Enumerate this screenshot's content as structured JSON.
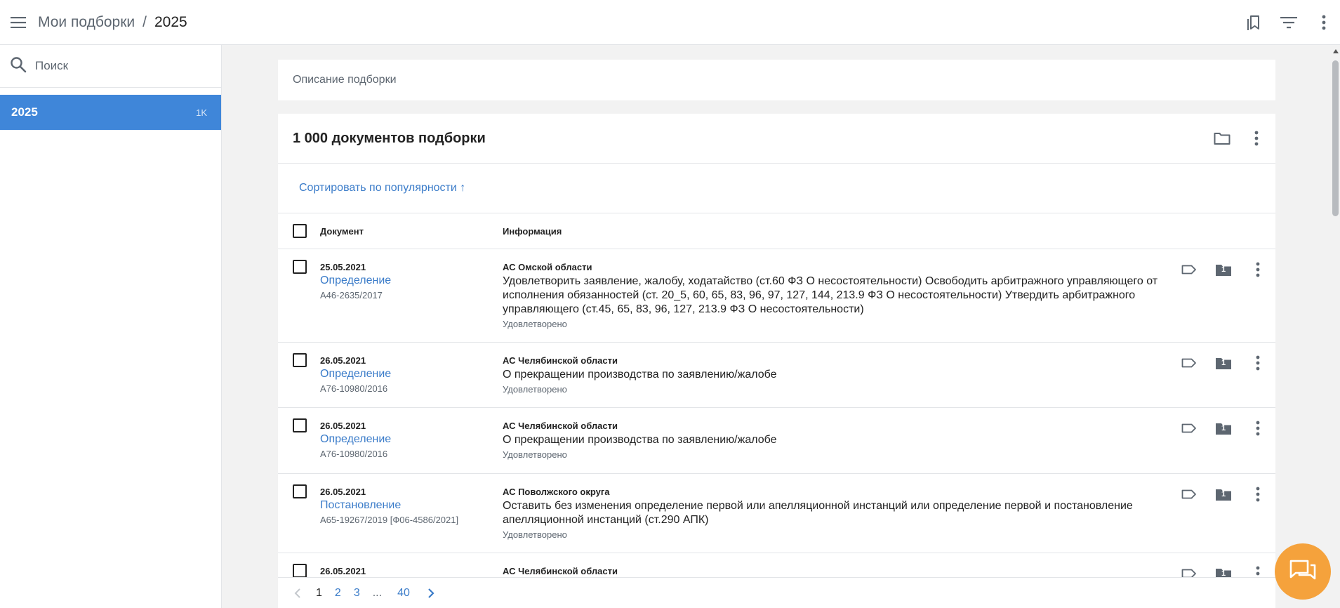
{
  "header": {
    "crumb_parent": "Мои подборки",
    "crumb_separator": "/",
    "crumb_current": "2025"
  },
  "sidebar": {
    "search_placeholder": "Поиск",
    "items": [
      {
        "label": "2025",
        "count": "1K"
      }
    ]
  },
  "main": {
    "description_placeholder": "Описание подборки",
    "docs_title": "1 000 документов подборки",
    "sort_label": "Сортировать по популярности ↑",
    "columns": {
      "document": "Документ",
      "info": "Информация"
    },
    "rows": [
      {
        "date": "25.05.2021",
        "type": "Определение",
        "case": "А46-2635/2017",
        "court": "АС Омской области",
        "text": "Удовлетворить заявление, жалобу, ходатайство (ст.60 ФЗ О несостоятельности) Освободить арбитражного управляющего от исполнения обязанностей (ст. 20_5, 60, 65, 83, 96, 97, 127, 144, 213.9 ФЗ О несостоятельности) Утвердить арбитражного управляющего (ст.45, 65, 83, 96, 127, 213.9 ФЗ О несостоятельности)",
        "status": "Удовлетворено",
        "folder_count": "1"
      },
      {
        "date": "26.05.2021",
        "type": "Определение",
        "case": "А76-10980/2016",
        "court": "АС Челябинской области",
        "text": "О прекращении производства по заявлению/жалобе",
        "status": "Удовлетворено",
        "folder_count": "1"
      },
      {
        "date": "26.05.2021",
        "type": "Определение",
        "case": "А76-10980/2016",
        "court": "АС Челябинской области",
        "text": "О прекращении производства по заявлению/жалобе",
        "status": "Удовлетворено",
        "folder_count": "1"
      },
      {
        "date": "26.05.2021",
        "type": "Постановление",
        "case": "А65-19267/2019 [Ф06-4586/2021]",
        "court": "АС Поволжского округа",
        "text": "Оставить без изменения определение первой или апелляционной инстанций или определение первой и постановление апелляционной инстанций (ст.290 АПК)",
        "status": "Удовлетворено",
        "folder_count": "1"
      },
      {
        "date": "26.05.2021",
        "type": "",
        "case": "",
        "court": "АС Челябинской области",
        "text": "",
        "status": "",
        "folder_count": "1"
      }
    ],
    "pagination": {
      "pages": [
        "1",
        "2",
        "3",
        "...",
        "40"
      ],
      "current": "1"
    }
  },
  "colors": {
    "accent": "#3f86d9",
    "link": "#3b7cc9",
    "chat": "#f5a23c",
    "muted": "#5d6670"
  }
}
